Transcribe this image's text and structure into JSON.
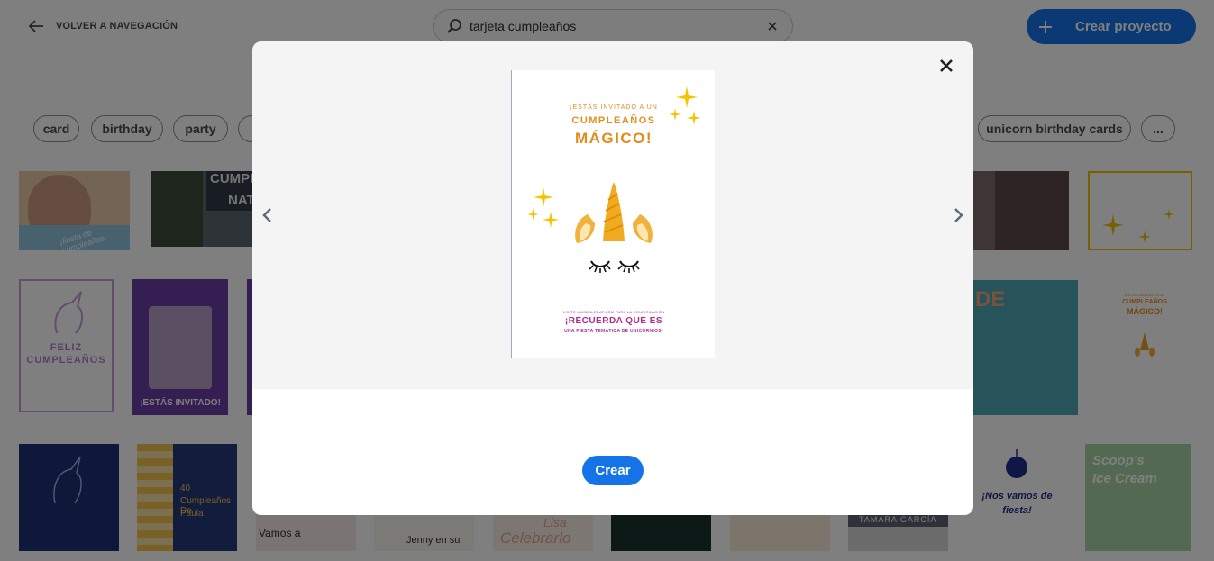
{
  "header": {
    "back_label": "VOLVER A NAVEGACIÓN",
    "search_value": "tarjeta cumpleaños",
    "create_project_label": "Crear proyecto"
  },
  "tags": [
    "card",
    "birthday",
    "party",
    "unicorn birthday cards",
    "..."
  ],
  "thumbnails": {
    "row1_a": "¡fiesta de cumpleaños!",
    "row1_b": "CUMPLE",
    "row1_b2": "NAT",
    "row2_a_title": "FELIZ",
    "row2_a_title2": "CUMPLEAÑOS",
    "row2_b": "¡ESTÁS INVITADO!",
    "row2_f1": "¡ESTÁS INVITADO A UN",
    "row2_f2": "CUMPLEAÑOS",
    "row2_f3": "MÁGICO!",
    "row3_b1": "40",
    "row3_b2": "Cumpleaños De",
    "row3_b3": "Paula",
    "row3_c": "Vamos a",
    "row3_d": "Jenny en su",
    "row3_e": "Lisa",
    "row3_e2": "Celebrarlo",
    "row3_h": "TAMARA GARCÍA",
    "row3_i1": "¡Nos vamos de",
    "row3_i2": "fiesta!",
    "row3_j1": "Scoop's",
    "row3_j2": "Ice Cream"
  },
  "modal": {
    "card": {
      "line1": "¡ESTÁS INVITADO A UN",
      "line2": "CUMPLEAÑOS",
      "line3": "MÁGICO!",
      "line4": "VISITE MASDALEDAT.COM PARA LA CONFIRMACIÓN",
      "line5": "¡RECUERDA QUE ES",
      "line6": "UNA FIESTA TEMÁTICA DE UNICORNIOS!"
    },
    "create_label": "Crear"
  },
  "icons": {
    "back": "arrow-left-icon",
    "search": "search-icon",
    "clear": "close-icon",
    "plus": "plus-icon",
    "modal_close": "close-icon",
    "prev": "chevron-left-icon",
    "next": "chevron-right-icon"
  },
  "colors": {
    "accent": "#1473e6",
    "card_orange": "#e28a1a",
    "card_magenta": "#b42a8d",
    "sparkle": "#f5c400"
  }
}
